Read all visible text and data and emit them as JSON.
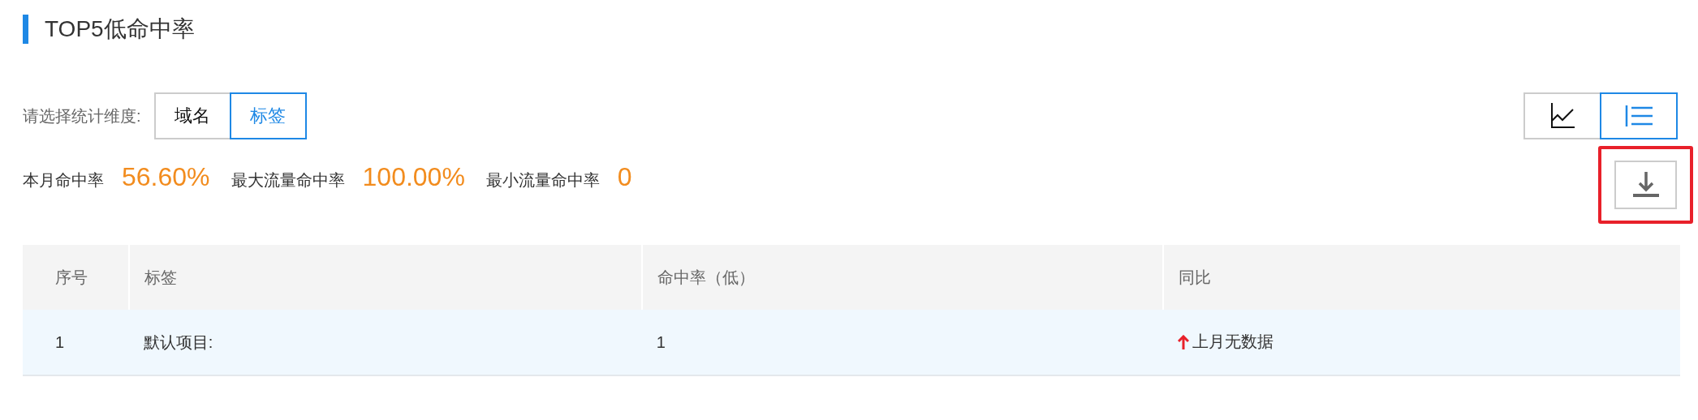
{
  "section_title": "TOP5低命中率",
  "dimension": {
    "label": "请选择统计维度:",
    "options": [
      {
        "label": "域名",
        "selected": false
      },
      {
        "label": "标签",
        "selected": true
      }
    ]
  },
  "view_toggle": [
    {
      "kind": "chart",
      "selected": false
    },
    {
      "kind": "list",
      "selected": true
    }
  ],
  "metrics": [
    {
      "label": "本月命中率",
      "value": "56.60%"
    },
    {
      "label": "最大流量命中率",
      "value": "100.00%"
    },
    {
      "label": "最小流量命中率",
      "value": "0"
    }
  ],
  "download": {
    "highlighted": true
  },
  "table": {
    "columns": [
      "序号",
      "标签",
      "命中率（低）",
      "同比"
    ],
    "rows": [
      {
        "cells": [
          "1",
          "默认项目:",
          "1",
          "上月无数据"
        ],
        "rising": true,
        "highlighted": true
      }
    ]
  }
}
